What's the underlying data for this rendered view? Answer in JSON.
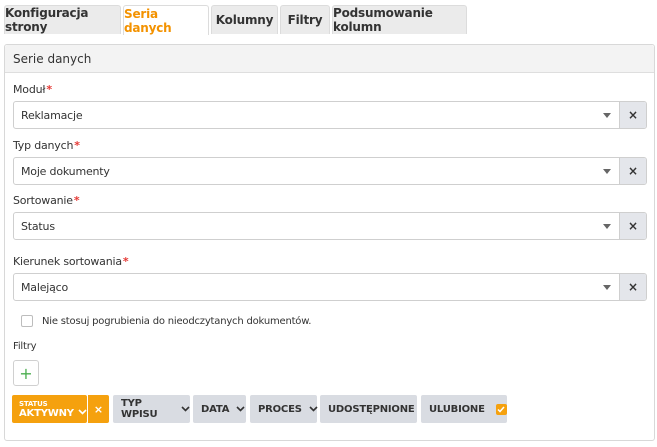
{
  "tabs": [
    {
      "label": "Konfiguracja strony",
      "active": false
    },
    {
      "label": "Seria danych",
      "active": true
    },
    {
      "label": "Kolumny",
      "active": false
    },
    {
      "label": "Filtry",
      "active": false
    },
    {
      "label": "Podsumowanie kolumn",
      "active": false
    }
  ],
  "panel": {
    "title": "Serie danych",
    "fields": [
      {
        "label": "Moduł",
        "required": "*",
        "value": "Reklamacje"
      },
      {
        "label": "Typ danych",
        "required": "*",
        "value": "Moje dokumenty"
      },
      {
        "label": "Sortowanie",
        "required": "*",
        "value": "Status"
      },
      {
        "label": "Kierunek sortowania",
        "required": "*",
        "value": "Malejąco"
      }
    ],
    "clear_symbol": "×",
    "checkbox_label": "Nie stosuj pogrubienia do nieodczytanych dokumentów.",
    "filters_label": "Filtry",
    "add_symbol": "+",
    "filter_chips": {
      "active_small": "STATUS",
      "active_big": "AKTYWNY",
      "active_remove": "×",
      "items": [
        "TYP WPISU",
        "DATA",
        "PROCES",
        "UDOSTĘPNIONE"
      ],
      "favorites": "ULUBIONE"
    }
  },
  "colors": {
    "accent": "#f39200",
    "chip_active": "#f5a10e",
    "chip_inactive": "#d9dce2",
    "required": "#e53935",
    "add": "#4caf50"
  },
  "icons": {
    "select_caret": "caret-down-icon",
    "chip_chevron": "chevron-down-icon",
    "favorite_check": "check-icon"
  }
}
